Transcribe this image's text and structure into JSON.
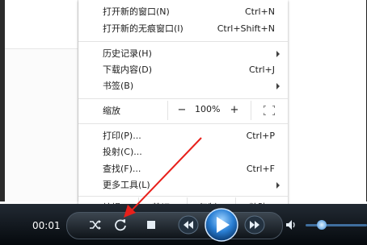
{
  "menu": {
    "items_top": [
      {
        "label": "打开新的窗口(N)",
        "shortcut": "Ctrl+N"
      },
      {
        "label": "打开新的无痕窗口(I)",
        "shortcut": "Ctrl+Shift+N"
      }
    ],
    "items_mid": [
      {
        "label": "历史记录(H)",
        "shortcut": ""
      },
      {
        "label": "下载内容(D)",
        "shortcut": "Ctrl+J"
      },
      {
        "label": "书签(B)",
        "shortcut": ""
      }
    ],
    "zoom": {
      "label": "缩放",
      "minus": "−",
      "value": "100%",
      "plus": "+"
    },
    "items_bottom": [
      {
        "label": "打印(P)...",
        "shortcut": "Ctrl+P"
      },
      {
        "label": "投射(C)...",
        "shortcut": ""
      },
      {
        "label": "查找(F)...",
        "shortcut": "Ctrl+F"
      },
      {
        "label": "更多工具(L)",
        "shortcut": ""
      }
    ],
    "edit": {
      "label": "编辑",
      "cut": "剪切(T)",
      "copy": "复制(C)",
      "paste": "粘贴(P)"
    }
  },
  "player": {
    "time": "00:01",
    "icons": [
      "shuffle-icon",
      "repeat-icon",
      "stop-icon",
      "previous-icon",
      "play-icon",
      "next-icon",
      "volume-icon"
    ],
    "volume_fraction": 0.2
  },
  "colors": {
    "annotation_arrow": "#e8201b",
    "player_bg": "#0b1016",
    "play_button": "#2a7fd4"
  }
}
